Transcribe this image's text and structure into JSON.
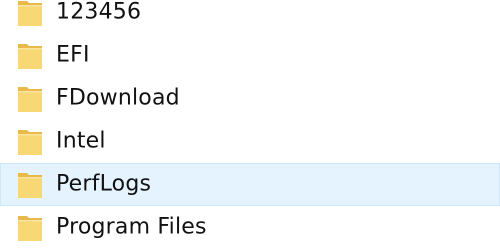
{
  "file_list": {
    "items": [
      {
        "name": "123456",
        "icon": "folder-icon",
        "hovered": false
      },
      {
        "name": "EFI",
        "icon": "folder-icon",
        "hovered": false
      },
      {
        "name": "FDownload",
        "icon": "folder-icon",
        "hovered": false
      },
      {
        "name": "Intel",
        "icon": "folder-icon",
        "hovered": false
      },
      {
        "name": "PerfLogs",
        "icon": "folder-icon",
        "hovered": true
      },
      {
        "name": "Program Files",
        "icon": "folder-icon",
        "hovered": false
      }
    ]
  },
  "colors": {
    "hover_background": "#e5f3ff",
    "hover_border": "#cce8ff",
    "folder_body": "#f8d775",
    "folder_shade": "#e9b949",
    "text": "#111111"
  }
}
